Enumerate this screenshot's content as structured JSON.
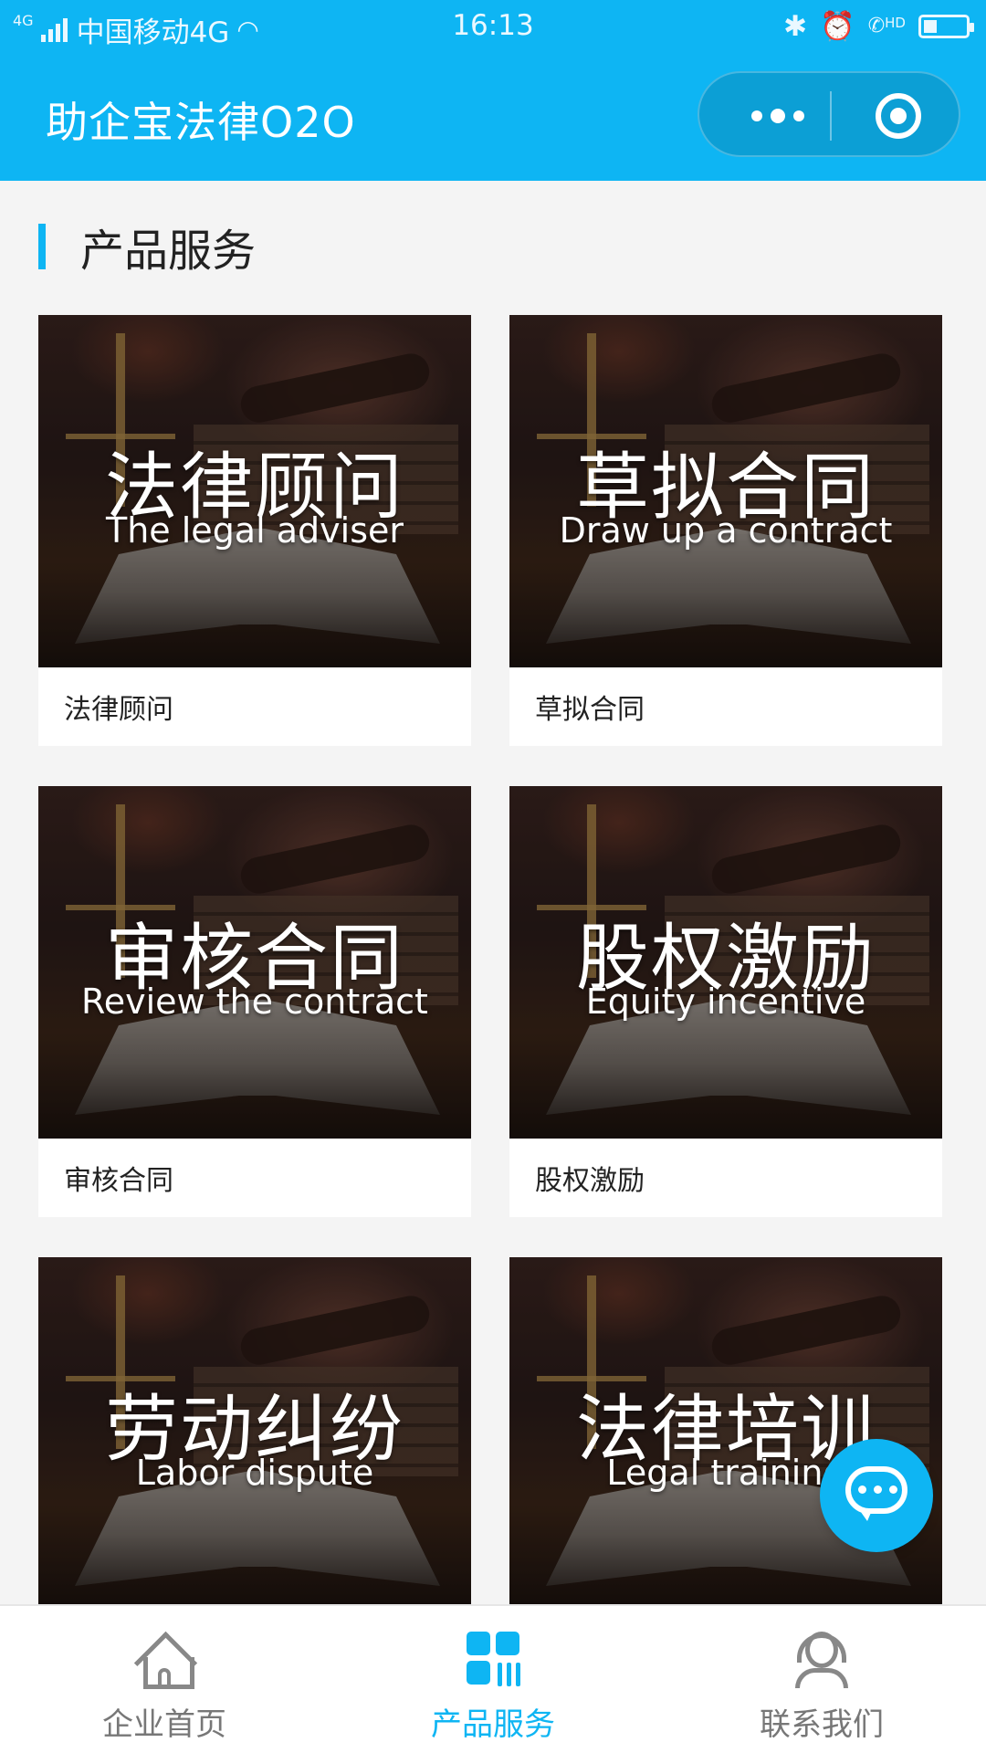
{
  "status_bar": {
    "network_tag": "4G",
    "carrier": "中国移动4G",
    "time": "16:13",
    "hd_tag": "HD"
  },
  "header": {
    "title": "助企宝法律O2O"
  },
  "section": {
    "title": "产品服务"
  },
  "cards": [
    {
      "title_cn": "法律顾问",
      "title_en": "The legal adviser",
      "label": "法律顾问"
    },
    {
      "title_cn": "草拟合同",
      "title_en": "Draw up a contract",
      "label": "草拟合同"
    },
    {
      "title_cn": "审核合同",
      "title_en": "Review the contract",
      "label": "审核合同"
    },
    {
      "title_cn": "股权激励",
      "title_en": "Equity incentive",
      "label": "股权激励"
    },
    {
      "title_cn": "劳动纠纷",
      "title_en": "Labor dispute",
      "label": ""
    },
    {
      "title_cn": "法律培训",
      "title_en": "Legal training",
      "label": ""
    }
  ],
  "tabbar": {
    "items": [
      {
        "label": "企业首页",
        "icon": "home-icon",
        "active": false
      },
      {
        "label": "产品服务",
        "icon": "grid-icon",
        "active": true
      },
      {
        "label": "联系我们",
        "icon": "contact-icon",
        "active": false
      }
    ]
  },
  "colors": {
    "accent": "#0eb5f3",
    "tab_inactive": "#777777"
  }
}
